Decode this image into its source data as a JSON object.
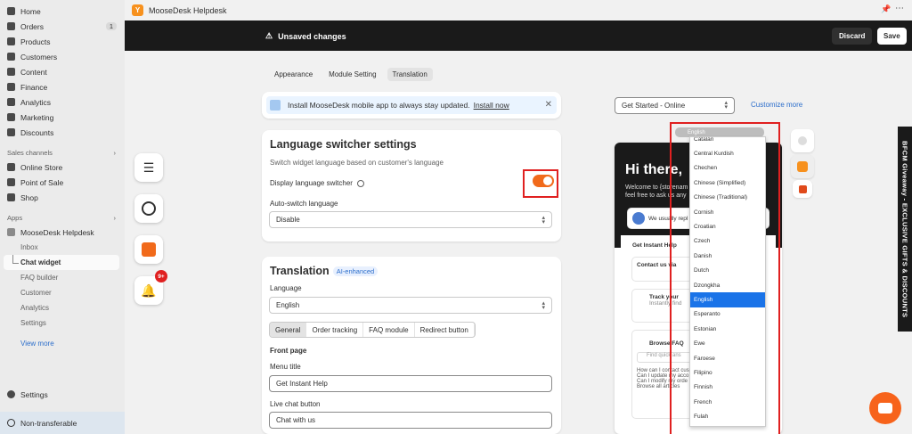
{
  "sidebar": {
    "items": [
      {
        "label": "Home",
        "icon": "home-icon"
      },
      {
        "label": "Orders",
        "icon": "orders-icon",
        "badge": "1"
      },
      {
        "label": "Products",
        "icon": "tag-icon"
      },
      {
        "label": "Customers",
        "icon": "person-icon"
      },
      {
        "label": "Content",
        "icon": "content-icon"
      },
      {
        "label": "Finance",
        "icon": "bank-icon"
      },
      {
        "label": "Analytics",
        "icon": "chart-icon"
      },
      {
        "label": "Marketing",
        "icon": "target-icon"
      },
      {
        "label": "Discounts",
        "icon": "discount-icon"
      }
    ],
    "sales_channels_label": "Sales channels",
    "channels": [
      {
        "label": "Online Store",
        "icon": "store-icon"
      },
      {
        "label": "Point of Sale",
        "icon": "pos-icon"
      },
      {
        "label": "Shop",
        "icon": "shop-icon"
      }
    ],
    "apps_label": "Apps",
    "app_name": "MooseDesk Helpdesk",
    "app_sub": [
      "Inbox",
      "Chat widget",
      "FAQ builder",
      "Customer",
      "Analytics",
      "Settings"
    ],
    "view_more": "View more",
    "settings": "Settings",
    "non_transferable": "Non-transferable"
  },
  "topbar": {
    "title": "MooseDesk Helpdesk"
  },
  "save_bar": {
    "message": "Unsaved changes",
    "discard": "Discard",
    "save": "Save"
  },
  "tabs": [
    "Appearance",
    "Module Setting",
    "Translation"
  ],
  "banner": {
    "text": "Install MooseDesk mobile app to always stay updated.",
    "link": "Install now"
  },
  "language_switcher": {
    "title": "Language switcher settings",
    "subtitle": "Switch widget language based on customer's language",
    "display_label": "Display language switcher",
    "auto_label": "Auto-switch language",
    "auto_value": "Disable",
    "toggle_on": true
  },
  "translation": {
    "title": "Translation",
    "ai_badge": "AI-enhanced",
    "language_label": "Language",
    "language_value": "English",
    "segments": [
      "General",
      "Order tracking",
      "FAQ module",
      "Redirect button"
    ],
    "front_page": "Front page",
    "menu_title_label": "Menu title",
    "menu_title_value": "Get Instant Help",
    "live_chat_label": "Live chat button",
    "live_chat_value": "Chat with us"
  },
  "preview": {
    "page_select": "Get Started - Online",
    "customize": "Customize more",
    "dropdown_selected": "English",
    "header_title": "Hi there,",
    "header_sub1": "Welcome to {storenam",
    "header_sub2": "feel free to ask us any",
    "we_usually": "We usually repl",
    "get_help": "Get Instant Help",
    "contact": "Contact us via",
    "track": "Track your",
    "track_sub": "Instantly find",
    "browse": "Browse FAQ",
    "find_search": "Find quick ans",
    "faq_1": "How can I contact cus",
    "faq_2": "Can I update my acco",
    "faq_3": "Can I modify my orde",
    "browse_all": "Browse all articles",
    "languages": [
      "Catalan",
      "Central Kurdish",
      "Chechen",
      "Chinese (Simplified)",
      "Chinese (Traditional)",
      "Cornish",
      "Croatian",
      "Czech",
      "Danish",
      "Dutch",
      "Dzongkha",
      "English",
      "Esperanto",
      "Estonian",
      "Ewe",
      "Faroese",
      "Filipino",
      "Finnish",
      "French",
      "Fulah"
    ]
  },
  "promo_vertical": "BFCM Giveaway - EXCLUSIVE GIFTS & DISCOUNTS",
  "notification_badge": "9+",
  "colors": {
    "accent_orange": "#f16a1b",
    "highlight_red": "#e02020",
    "dark": "#1a1a1a",
    "link_blue": "#2c6ecb"
  }
}
